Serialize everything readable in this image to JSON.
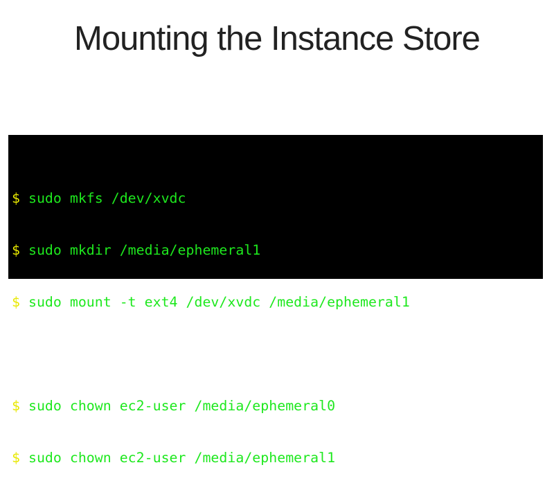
{
  "slide": {
    "title": "Mounting the Instance Store"
  },
  "terminal": {
    "prompt": "$",
    "colors": {
      "background": "#000000",
      "prompt": "#e8e800",
      "command": "#1ee81e"
    },
    "lines": [
      {
        "cmd": "sudo mkfs /dev/xvdc"
      },
      {
        "cmd": "sudo mkdir /media/ephemeral1"
      },
      {
        "cmd": "sudo mount -t ext4 /dev/xvdc /media/ephemeral1"
      },
      {
        "cmd": "sudo chown ec2-user /media/ephemeral0"
      },
      {
        "cmd": "sudo chown ec2-user /media/ephemeral1"
      }
    ]
  }
}
